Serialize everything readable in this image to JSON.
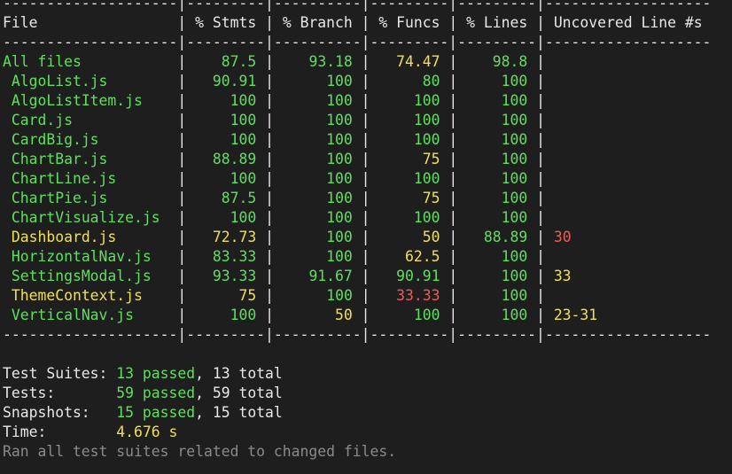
{
  "rule": "--------------------|---------|----------|---------|---------|-------------------",
  "headers": [
    "File",
    "% Stmts",
    "% Branch",
    "% Funcs",
    "% Lines",
    "Uncovered Line #s"
  ],
  "rows": [
    {
      "file": "All files",
      "indent": false,
      "stmts": "87.5",
      "branch": "93.18",
      "funcs": "74.47",
      "lines": "98.8",
      "uncovered": "",
      "c": {
        "file": "green",
        "stmts": "green",
        "branch": "green",
        "funcs": "yellow",
        "lines": "green",
        "uncovered": "white"
      }
    },
    {
      "file": "AlgoList.js",
      "indent": true,
      "stmts": "90.91",
      "branch": "100",
      "funcs": "80",
      "lines": "100",
      "uncovered": "",
      "c": {
        "file": "green",
        "stmts": "green",
        "branch": "green",
        "funcs": "green",
        "lines": "green",
        "uncovered": "white"
      }
    },
    {
      "file": "AlgoListItem.js",
      "indent": true,
      "stmts": "100",
      "branch": "100",
      "funcs": "100",
      "lines": "100",
      "uncovered": "",
      "c": {
        "file": "green",
        "stmts": "green",
        "branch": "green",
        "funcs": "green",
        "lines": "green",
        "uncovered": "white"
      }
    },
    {
      "file": "Card.js",
      "indent": true,
      "stmts": "100",
      "branch": "100",
      "funcs": "100",
      "lines": "100",
      "uncovered": "",
      "c": {
        "file": "green",
        "stmts": "green",
        "branch": "green",
        "funcs": "green",
        "lines": "green",
        "uncovered": "white"
      }
    },
    {
      "file": "CardBig.js",
      "indent": true,
      "stmts": "100",
      "branch": "100",
      "funcs": "100",
      "lines": "100",
      "uncovered": "",
      "c": {
        "file": "green",
        "stmts": "green",
        "branch": "green",
        "funcs": "green",
        "lines": "green",
        "uncovered": "white"
      }
    },
    {
      "file": "ChartBar.js",
      "indent": true,
      "stmts": "88.89",
      "branch": "100",
      "funcs": "75",
      "lines": "100",
      "uncovered": "",
      "c": {
        "file": "green",
        "stmts": "green",
        "branch": "green",
        "funcs": "yellow",
        "lines": "green",
        "uncovered": "white"
      }
    },
    {
      "file": "ChartLine.js",
      "indent": true,
      "stmts": "100",
      "branch": "100",
      "funcs": "100",
      "lines": "100",
      "uncovered": "",
      "c": {
        "file": "green",
        "stmts": "green",
        "branch": "green",
        "funcs": "green",
        "lines": "green",
        "uncovered": "white"
      }
    },
    {
      "file": "ChartPie.js",
      "indent": true,
      "stmts": "87.5",
      "branch": "100",
      "funcs": "75",
      "lines": "100",
      "uncovered": "",
      "c": {
        "file": "green",
        "stmts": "green",
        "branch": "green",
        "funcs": "yellow",
        "lines": "green",
        "uncovered": "white"
      }
    },
    {
      "file": "ChartVisualize.js",
      "indent": true,
      "stmts": "100",
      "branch": "100",
      "funcs": "100",
      "lines": "100",
      "uncovered": "",
      "c": {
        "file": "green",
        "stmts": "green",
        "branch": "green",
        "funcs": "green",
        "lines": "green",
        "uncovered": "white"
      }
    },
    {
      "file": "Dashboard.js",
      "indent": true,
      "stmts": "72.73",
      "branch": "100",
      "funcs": "50",
      "lines": "88.89",
      "uncovered": "30",
      "c": {
        "file": "yellow",
        "stmts": "yellow",
        "branch": "green",
        "funcs": "yellow",
        "lines": "green",
        "uncovered": "red"
      }
    },
    {
      "file": "HorizontalNav.js",
      "indent": true,
      "stmts": "83.33",
      "branch": "100",
      "funcs": "62.5",
      "lines": "100",
      "uncovered": "",
      "c": {
        "file": "green",
        "stmts": "green",
        "branch": "green",
        "funcs": "yellow",
        "lines": "green",
        "uncovered": "white"
      }
    },
    {
      "file": "SettingsModal.js",
      "indent": true,
      "stmts": "93.33",
      "branch": "91.67",
      "funcs": "90.91",
      "lines": "100",
      "uncovered": "33",
      "c": {
        "file": "green",
        "stmts": "green",
        "branch": "green",
        "funcs": "green",
        "lines": "green",
        "uncovered": "yellow"
      }
    },
    {
      "file": "ThemeContext.js",
      "indent": true,
      "stmts": "75",
      "branch": "100",
      "funcs": "33.33",
      "lines": "100",
      "uncovered": "",
      "c": {
        "file": "yellow",
        "stmts": "yellow",
        "branch": "green",
        "funcs": "red",
        "lines": "green",
        "uncovered": "white"
      }
    },
    {
      "file": "VerticalNav.js",
      "indent": true,
      "stmts": "100",
      "branch": "50",
      "funcs": "100",
      "lines": "100",
      "uncovered": "23-31",
      "c": {
        "file": "green",
        "stmts": "green",
        "branch": "yellow",
        "funcs": "green",
        "lines": "green",
        "uncovered": "yellow"
      }
    }
  ],
  "summary": {
    "suites": {
      "label": "Test Suites:",
      "passed": "13 passed",
      "total": ", 13 total"
    },
    "tests": {
      "label": "Tests:",
      "passed": "59 passed",
      "total": ", 59 total"
    },
    "snapshots": {
      "label": "Snapshots:",
      "passed": "15 passed",
      "total": ", 15 total"
    },
    "time": {
      "label": "Time:",
      "value": "4.676 s"
    },
    "note": "Ran all test suites related to changed files."
  },
  "colors": {
    "background": "#1e1e1e",
    "text": "#e8e8e8",
    "green": "#5de05d",
    "yellow": "#f0e050",
    "red": "#ef5b5b",
    "dim": "#8a8a8a"
  }
}
